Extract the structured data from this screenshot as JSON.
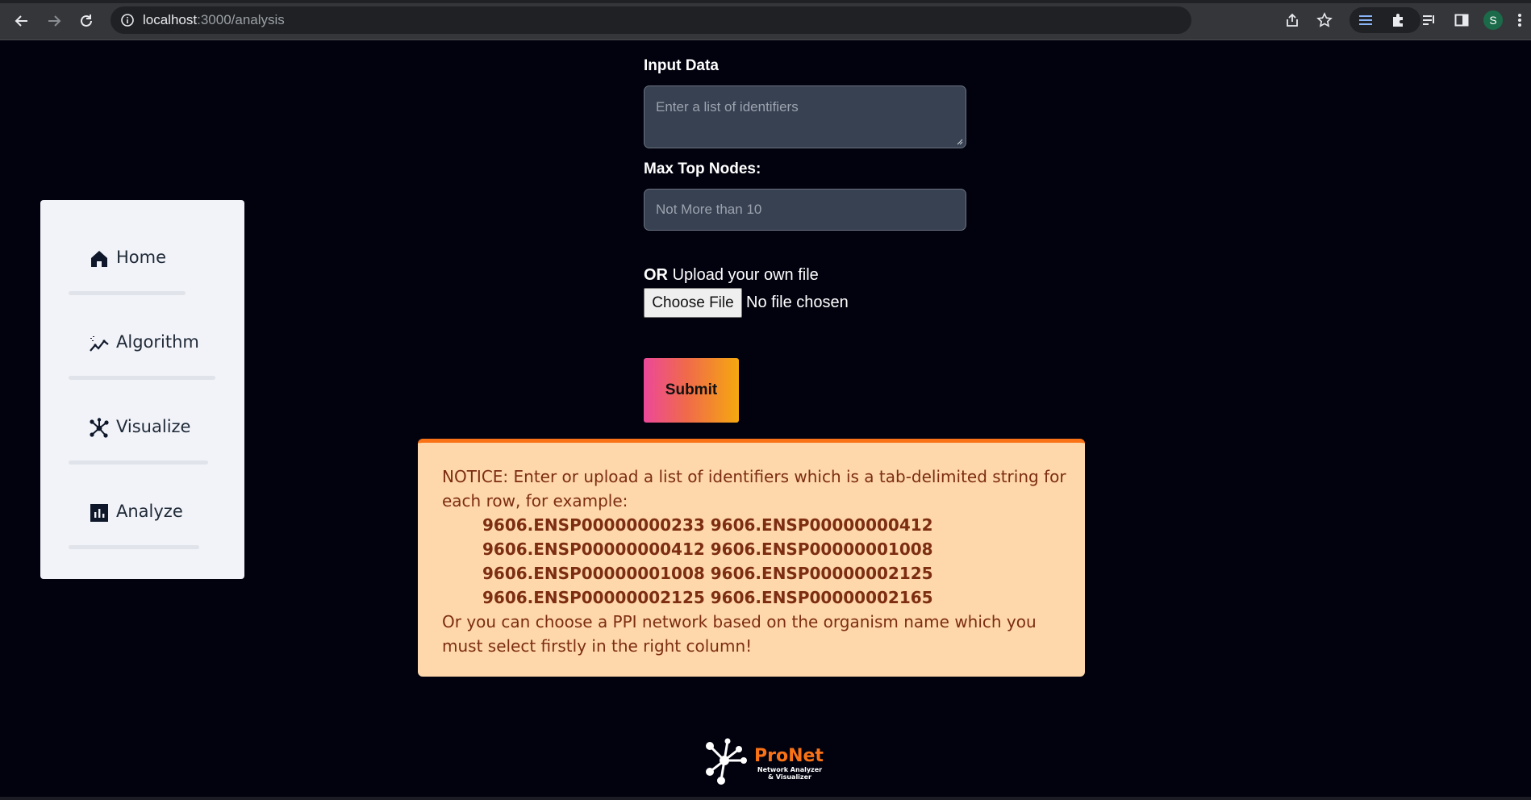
{
  "browser": {
    "url_host": "localhost",
    "url_path": ":3000/analysis",
    "profile_initial": "S"
  },
  "sidebar": {
    "items": [
      {
        "label": "Home",
        "icon": "home-icon"
      },
      {
        "label": "Algorithm",
        "icon": "trend-line-icon"
      },
      {
        "label": "Visualize",
        "icon": "network-icon"
      },
      {
        "label": "Analyze",
        "icon": "bar-chart-icon"
      }
    ]
  },
  "form": {
    "input_label": "Input Data",
    "input_placeholder": "Enter a list of identifiers",
    "max_nodes_label": "Max Top Nodes:",
    "max_nodes_placeholder": "Not More than 10",
    "upload_or": "OR",
    "upload_label": "Upload your own file",
    "choose_file": "Choose File",
    "no_file": "No file chosen",
    "submit": "Submit"
  },
  "notice": {
    "line1": "NOTICE: Enter or upload a list of identifiers which is a tab-delimited string for",
    "line2": "each row, for example:",
    "examples": [
      "9606.ENSP00000000233   9606.ENSP00000000412",
      "9606.ENSP00000000412   9606.ENSP00000001008",
      "9606.ENSP00000001008   9606.ENSP00000002125",
      "9606.ENSP00000002125   9606.ENSP00000002165"
    ],
    "line3": "Or you can choose a PPI network based on the organism name which you",
    "line4": "must select firstly in the right column!"
  },
  "footer": {
    "brand": "ProNet",
    "tagline_1": "Network Analyzer",
    "tagline_2": "& Visualizer"
  },
  "colors": {
    "background": "#02020f",
    "accent": "#f97316",
    "notice_bg": "#fed7aa",
    "notice_text": "#7c2d12"
  }
}
